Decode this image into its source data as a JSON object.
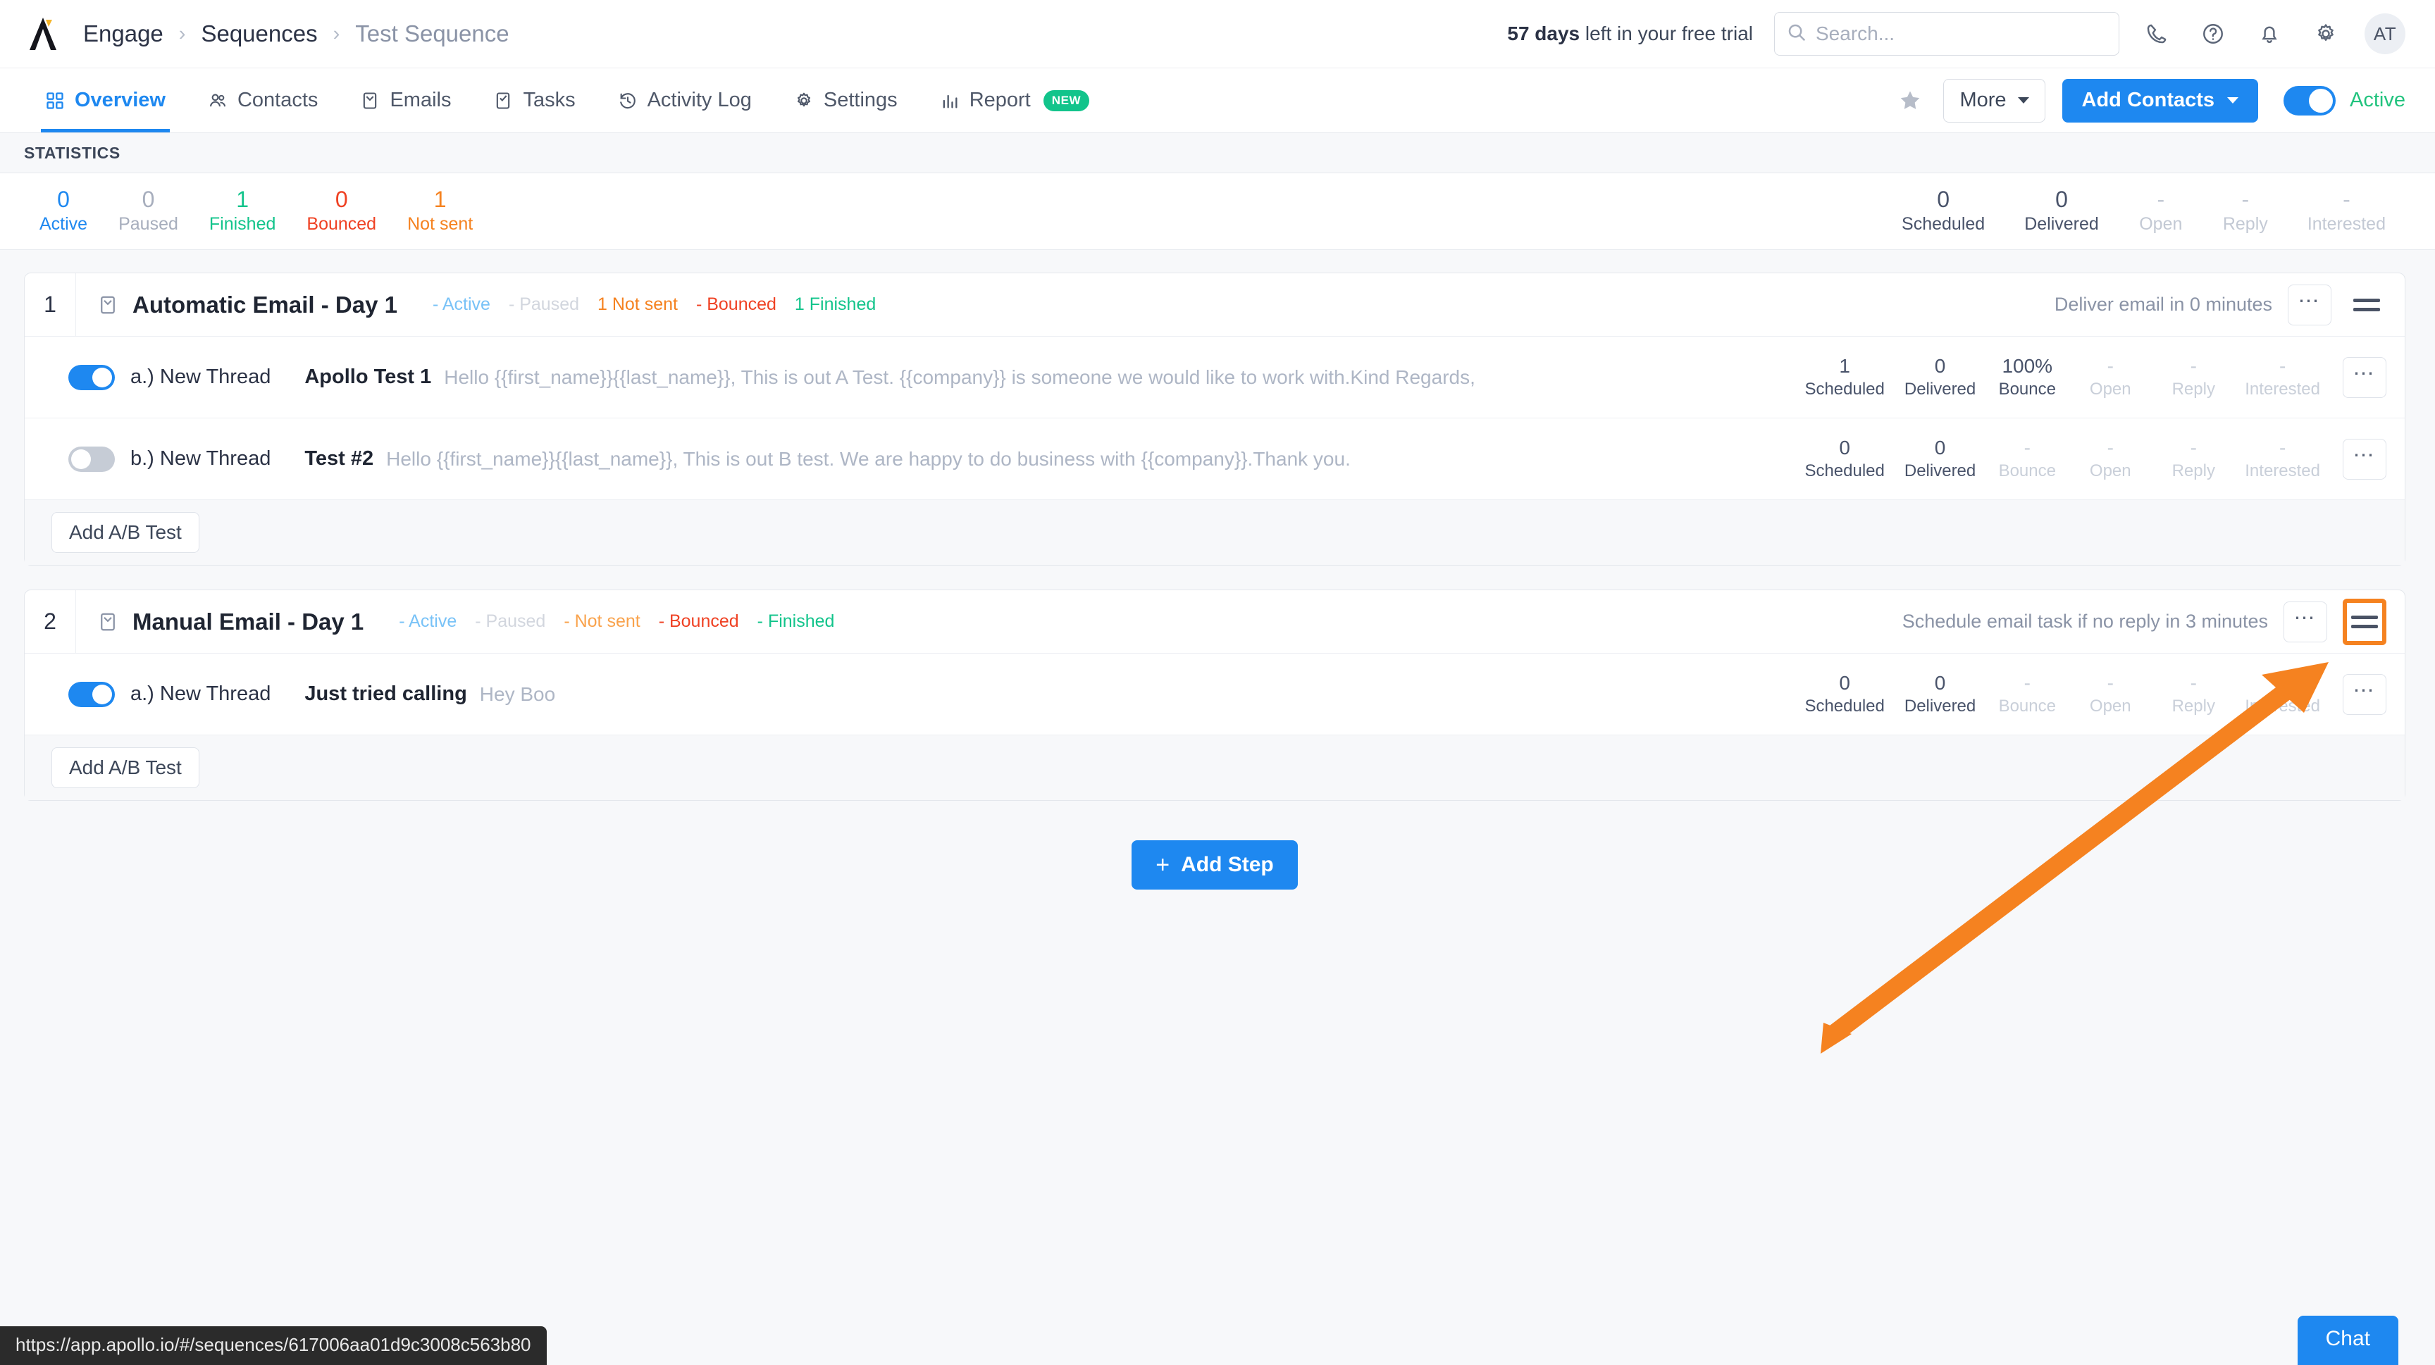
{
  "header": {
    "logo_name": "apollo-logo",
    "breadcrumb": [
      "Engage",
      "Sequences",
      "Test Sequence"
    ],
    "trial_days": "57 days",
    "trial_rest": " left in your free trial",
    "search_placeholder": "Search...",
    "icons": [
      "phone-icon",
      "help-icon",
      "bell-icon",
      "gear-icon"
    ],
    "avatar_initials": "AT"
  },
  "nav": {
    "tabs": [
      {
        "label": "Overview",
        "icon": "grid-icon",
        "active": true
      },
      {
        "label": "Contacts",
        "icon": "people-icon",
        "active": false
      },
      {
        "label": "Emails",
        "icon": "envelope-icon",
        "active": false
      },
      {
        "label": "Tasks",
        "icon": "checkbox-icon",
        "active": false
      },
      {
        "label": "Activity Log",
        "icon": "history-icon",
        "active": false
      },
      {
        "label": "Settings",
        "icon": "gear-icon",
        "active": false
      },
      {
        "label": "Report",
        "icon": "bar-chart-icon",
        "active": false,
        "badge": "NEW"
      }
    ],
    "star_icon": "star-icon",
    "more_label": "More",
    "add_contacts_label": "Add Contacts",
    "toggle_state_label": "Active"
  },
  "statistics": {
    "section_label": "STATISTICS",
    "left": [
      {
        "num": "0",
        "label": "Active",
        "color": "#1e88f0"
      },
      {
        "num": "0",
        "label": "Paused",
        "color": "#a7aebd"
      },
      {
        "num": "1",
        "label": "Finished",
        "color": "#12c48b"
      },
      {
        "num": "0",
        "label": "Bounced",
        "color": "#ef4123"
      },
      {
        "num": "1",
        "label": "Not sent",
        "color": "#f58220"
      }
    ],
    "right": [
      {
        "num": "0",
        "label": "Scheduled",
        "dim": false
      },
      {
        "num": "0",
        "label": "Delivered",
        "dim": false
      },
      {
        "num": "-",
        "label": "Open",
        "dim": true
      },
      {
        "num": "-",
        "label": "Reply",
        "dim": true
      },
      {
        "num": "-",
        "label": "Interested",
        "dim": true
      }
    ]
  },
  "steps": [
    {
      "number": "1",
      "title": "Automatic Email - Day 1",
      "badges": [
        {
          "text": "- Active",
          "state": "off"
        },
        {
          "text": "- Paused",
          "state": "off"
        },
        {
          "text": "1 Not sent",
          "state": "on"
        },
        {
          "text": "- Bounced",
          "state": "off"
        },
        {
          "text": "1 Finished",
          "state": "on"
        }
      ],
      "meta": "Deliver email in 0 minutes",
      "handle_highlighted": false,
      "variants": [
        {
          "toggle_on": true,
          "label": "a.) New Thread",
          "subject": "Apollo Test 1",
          "preview": "Hello {{first_name}}{{last_name}}, This is out A Test. {{company}} is someone we would like to work with.Kind Regards,",
          "metrics": [
            {
              "num": "1",
              "label": "Scheduled",
              "dim": false
            },
            {
              "num": "0",
              "label": "Delivered",
              "dim": false
            },
            {
              "num": "100%",
              "label": "Bounce",
              "dim": false
            },
            {
              "num": "-",
              "label": "Open",
              "dim": true
            },
            {
              "num": "-",
              "label": "Reply",
              "dim": true
            },
            {
              "num": "-",
              "label": "Interested",
              "dim": true
            }
          ]
        },
        {
          "toggle_on": false,
          "label": "b.) New Thread",
          "subject": "Test #2",
          "preview": "Hello {{first_name}}{{last_name}}, This is out B test. We are happy to do business with {{company}}.Thank you.",
          "metrics": [
            {
              "num": "0",
              "label": "Scheduled",
              "dim": false
            },
            {
              "num": "0",
              "label": "Delivered",
              "dim": false
            },
            {
              "num": "-",
              "label": "Bounce",
              "dim": true
            },
            {
              "num": "-",
              "label": "Open",
              "dim": true
            },
            {
              "num": "-",
              "label": "Reply",
              "dim": true
            },
            {
              "num": "-",
              "label": "Interested",
              "dim": true
            }
          ]
        }
      ],
      "ab_label": "Add A/B Test"
    },
    {
      "number": "2",
      "title": "Manual Email - Day 1",
      "badges": [
        {
          "text": "- Active",
          "state": "off"
        },
        {
          "text": "- Paused",
          "state": "off"
        },
        {
          "text": "- Not sent",
          "state": "off"
        },
        {
          "text": "- Bounced",
          "state": "on"
        },
        {
          "text": "- Finished",
          "state": "on"
        }
      ],
      "meta": "Schedule email task if no reply in 3 minutes",
      "handle_highlighted": true,
      "variants": [
        {
          "toggle_on": true,
          "label": "a.) New Thread",
          "subject": "Just tried calling",
          "preview": "Hey Boo",
          "metrics": [
            {
              "num": "0",
              "label": "Scheduled",
              "dim": false
            },
            {
              "num": "0",
              "label": "Delivered",
              "dim": false
            },
            {
              "num": "-",
              "label": "Bounce",
              "dim": true
            },
            {
              "num": "-",
              "label": "Open",
              "dim": true
            },
            {
              "num": "-",
              "label": "Reply",
              "dim": true
            },
            {
              "num": "-",
              "label": "Interested",
              "dim": true
            }
          ]
        }
      ],
      "ab_label": "Add A/B Test"
    }
  ],
  "add_step_label": "Add Step",
  "status_bar_url": "https://app.apollo.io/#/sequences/617006aa01d9c3008c563b80",
  "chat_label": "Chat",
  "annotation": {
    "color": "#f58220",
    "name": "pointer-arrow"
  }
}
